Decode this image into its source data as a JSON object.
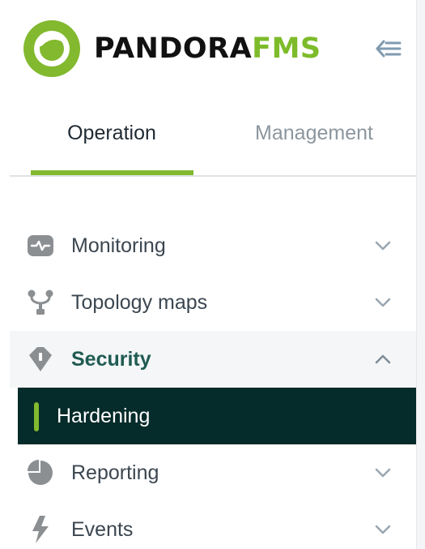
{
  "brand": {
    "name_main": "PANDORA",
    "name_accent": "FMS",
    "accent_color": "#7dbb2a",
    "logo_icon": "pandora-fms-logo"
  },
  "header": {
    "collapse_icon": "collapse-arrow-icon"
  },
  "tabs": [
    {
      "label": "Operation",
      "active": true
    },
    {
      "label": "Management",
      "active": false
    }
  ],
  "tab_indicator_color": "#82b92e",
  "menu": {
    "items": [
      {
        "label": "Monitoring",
        "icon": "monitor-heartbeat-icon",
        "expanded": false
      },
      {
        "label": "Topology maps",
        "icon": "topology-icon",
        "expanded": false
      },
      {
        "label": "Security",
        "icon": "shield-icon",
        "expanded": true,
        "children": [
          {
            "label": "Hardening",
            "active": true
          }
        ]
      },
      {
        "label": "Reporting",
        "icon": "pie-chart-icon",
        "expanded": false
      },
      {
        "label": "Events",
        "icon": "lightning-icon",
        "expanded": false
      }
    ]
  },
  "colors": {
    "active_submenu_bg": "#052b2a",
    "active_label": "#1f5b52",
    "icon_gray": "#8c8f92"
  }
}
